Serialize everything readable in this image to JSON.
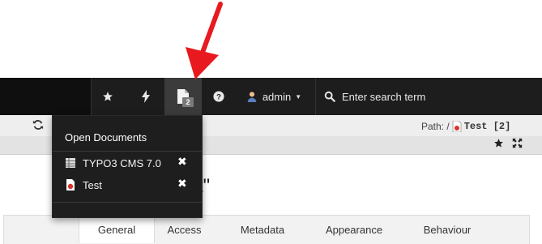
{
  "toolbar": {
    "bookmarks_icon": "star-icon",
    "clearcache_icon": "bolt-icon",
    "opendocs_icon": "document-icon",
    "opendocs_count": "2",
    "help_icon": "question-icon",
    "user_name": "admin",
    "search_placeholder": "Enter search term"
  },
  "docheader": {
    "path_label": "Path: /",
    "page_title": "Test [2]"
  },
  "page": {
    "heading_fragment": "t\""
  },
  "tabs": [
    "General",
    "Access",
    "Metadata",
    "Appearance",
    "Behaviour"
  ],
  "open_documents": {
    "title": "Open Documents",
    "items": [
      {
        "label": "TYPO3 CMS 7.0",
        "icon": "table-icon"
      },
      {
        "label": "Test",
        "icon": "page-icon"
      }
    ]
  },
  "colors": {
    "toolbar_bg": "#1d1d1d",
    "dropdown_bg": "#1e1e1e",
    "annotation_arrow": "#e8191f"
  }
}
